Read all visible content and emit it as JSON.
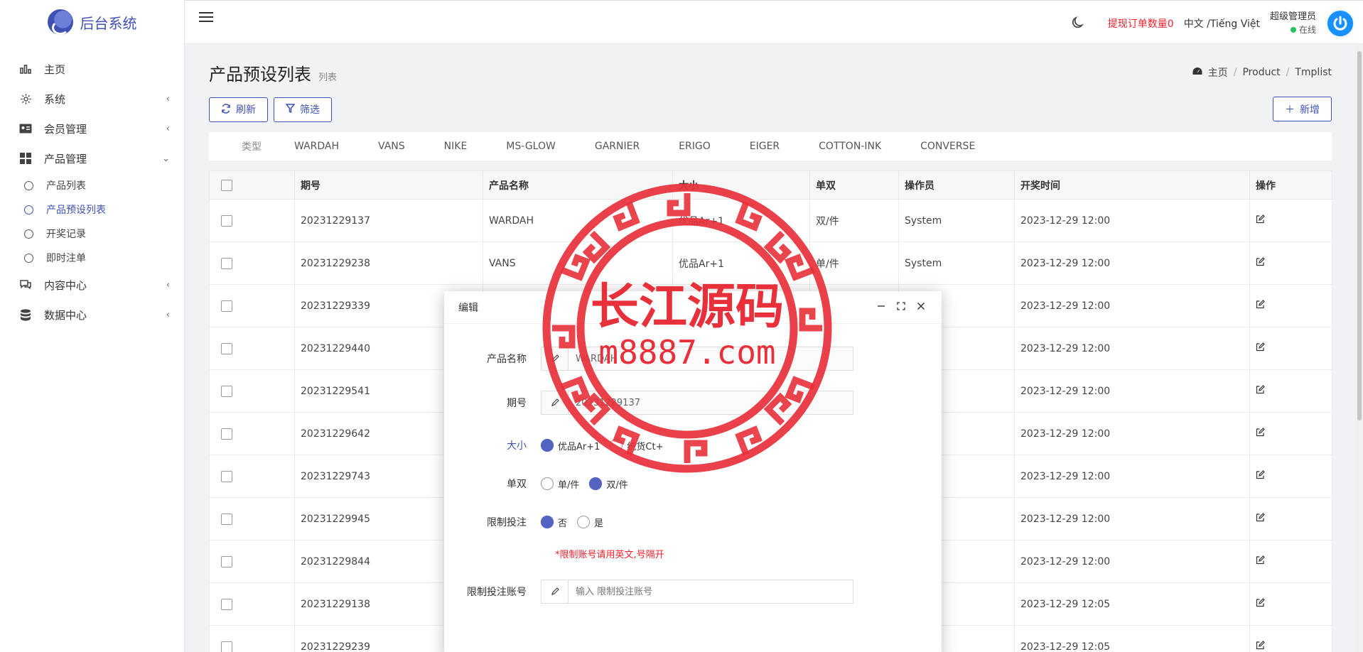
{
  "brand": {
    "name": "后台系统"
  },
  "sidebar": {
    "items": [
      {
        "label": "主页",
        "icon": "bar-chart-icon",
        "chevron": ""
      },
      {
        "label": "系统",
        "icon": "gear-icon",
        "chevron": "‹"
      },
      {
        "label": "会员管理",
        "icon": "id-card-icon",
        "chevron": "‹"
      },
      {
        "label": "产品管理",
        "icon": "grid-icon",
        "chevron": "⌄"
      }
    ],
    "sub": [
      {
        "label": "产品列表",
        "active": false
      },
      {
        "label": "产品预设列表",
        "active": true
      },
      {
        "label": "开奖记录",
        "active": false
      },
      {
        "label": "即时注单",
        "active": false
      }
    ],
    "more": [
      {
        "label": "内容中心",
        "icon": "chat-icon",
        "chevron": "‹"
      },
      {
        "label": "数据中心",
        "icon": "database-icon",
        "chevron": "‹"
      }
    ]
  },
  "topbar": {
    "withdraw": "提现订单数量0",
    "lang": "中文 /Tiếng Việt",
    "user_name": "超级管理员",
    "user_status": "在线"
  },
  "page": {
    "title": "产品预设列表",
    "subtitle": "列表",
    "breadcrumb": {
      "home": "主页",
      "b1": "Product",
      "b2": "Tmplist"
    }
  },
  "toolbar": {
    "refresh": "刷新",
    "filter": "筛选",
    "add": "新增"
  },
  "types": {
    "label": "类型",
    "items": [
      "WARDAH",
      "VANS",
      "NIKE",
      "MS-GLOW",
      "GARNIER",
      "ERIGO",
      "EIGER",
      "COTTON-INK",
      "CONVERSE"
    ]
  },
  "table": {
    "headers": [
      "期号",
      "产品名称",
      "大小",
      "单双",
      "操作员",
      "开奖时间",
      "操作"
    ],
    "rows": [
      [
        "20231229137",
        "WARDAH",
        "优品Ar+1",
        "双/件",
        "System",
        "2023-12-29 12:00"
      ],
      [
        "20231229238",
        "VANS",
        "优品Ar+1",
        "单/件",
        "System",
        "2023-12-29 12:00"
      ],
      [
        "20231229339",
        "",
        "",
        "",
        "",
        "2023-12-29 12:00"
      ],
      [
        "20231229440",
        "",
        "",
        "",
        "",
        "2023-12-29 12:00"
      ],
      [
        "20231229541",
        "",
        "",
        "",
        "",
        "2023-12-29 12:00"
      ],
      [
        "20231229642",
        "",
        "",
        "",
        "",
        "2023-12-29 12:00"
      ],
      [
        "20231229743",
        "",
        "",
        "",
        "",
        "2023-12-29 12:00"
      ],
      [
        "20231229945",
        "",
        "",
        "",
        "",
        "2023-12-29 12:00"
      ],
      [
        "20231229844",
        "",
        "",
        "",
        "",
        "2023-12-29 12:00"
      ],
      [
        "20231229138",
        "",
        "",
        "",
        "",
        "2023-12-29 12:05"
      ],
      [
        "20231229239",
        "",
        "",
        "",
        "",
        "2023-12-29 12:05"
      ]
    ]
  },
  "modal": {
    "title": "编辑",
    "product_label": "产品名称",
    "product_value": "WARDAH",
    "period_label": "期号",
    "period_value": "20231229137",
    "size_label": "大小",
    "size_opt1": "优品Ar+1",
    "size_opt2": "统货Ct+",
    "odd_label": "单双",
    "odd_opt1": "单/件",
    "odd_opt2": "双/件",
    "limit_label": "限制投注",
    "limit_opt1": "否",
    "limit_opt2": "是",
    "warning": "*限制账号请用英文,号隔开",
    "acct_label": "限制投注账号",
    "acct_placeholder": "输入 限制投注账号"
  },
  "watermark": {
    "line1": "长江源码",
    "line2": "m8887.com"
  },
  "colors": {
    "accent": "#3f51b5",
    "danger": "#f5222d",
    "seal": "#e8303a"
  }
}
